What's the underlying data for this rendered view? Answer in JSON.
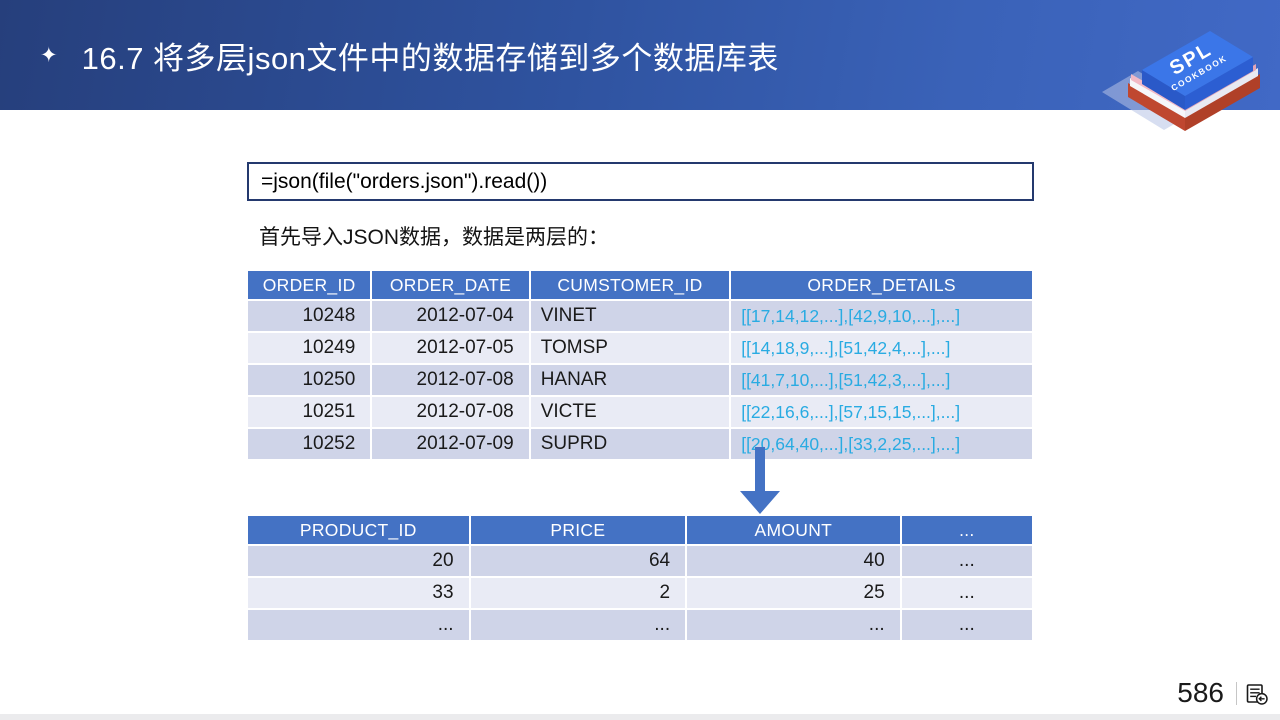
{
  "slide": {
    "title_bullet": "✦",
    "title": "16.7 将多层json文件中的数据存储到多个数据库表",
    "code": "=json(file(\"orders.json\").read())",
    "intro": "首先导入JSON数据，数据是两层的：",
    "page_number": "586"
  },
  "logo": {
    "line1": "SPL",
    "line2": "COOKBOOK"
  },
  "orders_table": {
    "headers": [
      "ORDER_ID",
      "ORDER_DATE",
      "CUMSTOMER_ID",
      "ORDER_DETAILS"
    ],
    "rows": [
      [
        "10248",
        "2012-07-04",
        "VINET",
        "[[17,14,12,...],[42,9,10,...],...]"
      ],
      [
        "10249",
        "2012-07-05",
        "TOMSP",
        "[[14,18,9,...],[51,42,4,...],...]"
      ],
      [
        "10250",
        "2012-07-08",
        "HANAR",
        "[[41,7,10,...],[51,42,3,...],...]"
      ],
      [
        "10251",
        "2012-07-08",
        "VICTE",
        "[[22,16,6,...],[57,15,15,...],...]"
      ],
      [
        "10252",
        "2012-07-09",
        "SUPRD",
        "[[20,64,40,...],[33,2,25,...],...]"
      ]
    ]
  },
  "details_table": {
    "headers": [
      "PRODUCT_ID",
      "PRICE",
      "AMOUNT",
      "..."
    ],
    "rows": [
      [
        "20",
        "64",
        "40",
        "..."
      ],
      [
        "33",
        "2",
        "25",
        "..."
      ],
      [
        "...",
        "...",
        "...",
        "..."
      ]
    ]
  },
  "colors": {
    "header_gradient_start": "#263f7c",
    "header_gradient_end": "#4169c6",
    "table_header_blue": "#4472c4",
    "row_dark": "#cfd4e8",
    "row_light": "#e9ebf5",
    "detail_cyan": "#29abe2",
    "arrow_blue": "#4472c4",
    "book_blue": "#3b76e8",
    "book_red": "#bf4730"
  }
}
